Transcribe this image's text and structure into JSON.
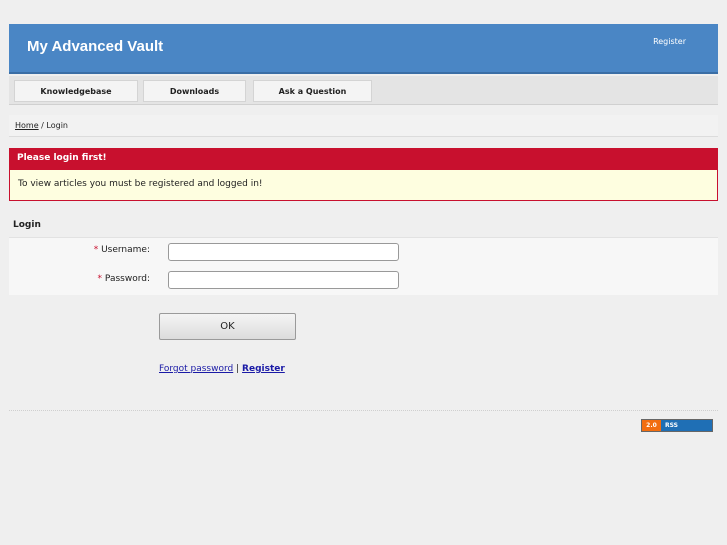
{
  "header": {
    "title": "My Advanced Vault",
    "register_label": "Register"
  },
  "nav": {
    "items": [
      {
        "label": "Knowledgebase"
      },
      {
        "label": "Downloads"
      },
      {
        "label": "Ask a Question"
      }
    ]
  },
  "breadcrumb": {
    "home": "Home",
    "separator": "/",
    "current": "Login"
  },
  "alert": {
    "title": "Please login first!",
    "message": "To view articles you must be registered and logged in!"
  },
  "login": {
    "title": "Login",
    "required_mark": "*",
    "username_label": "Username:",
    "username_value": "",
    "password_label": "Password:",
    "password_value": "",
    "ok_label": "OK",
    "forgot_label": "Forgot password",
    "links_separator": "|",
    "register_label": "Register"
  },
  "footer": {
    "rss_version": "2.0",
    "rss_label": "RSS"
  },
  "colors": {
    "header_blue": "#4a86c5",
    "alert_red": "#c8102e",
    "alert_bg": "#fefee0",
    "link_blue": "#1a1aa6"
  }
}
